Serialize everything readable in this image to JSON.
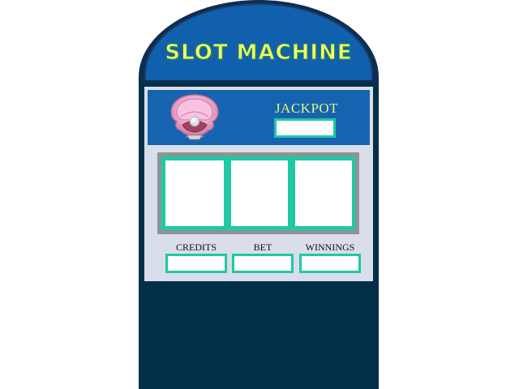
{
  "machine": {
    "title": "SLOT MACHINE",
    "jackpot_label": "JACKPOT",
    "jackpot_value": "",
    "shell_icon": "pearl-shell-icon"
  },
  "reels": [
    {
      "symbol": ""
    },
    {
      "symbol": ""
    },
    {
      "symbol": ""
    }
  ],
  "stats": {
    "credits_label": "CREDITS",
    "credits_value": "",
    "bet_label": "BET",
    "bet_value": "",
    "winnings_label": "WINNINGS",
    "winnings_value": ""
  },
  "colors": {
    "cabinet": "#033048",
    "dome": "#1160ad",
    "panel": "#d9deea",
    "accent_teal": "#1fc9a4",
    "title_yellow": "#f4ff5e",
    "reel_frame": "#8e9399"
  }
}
